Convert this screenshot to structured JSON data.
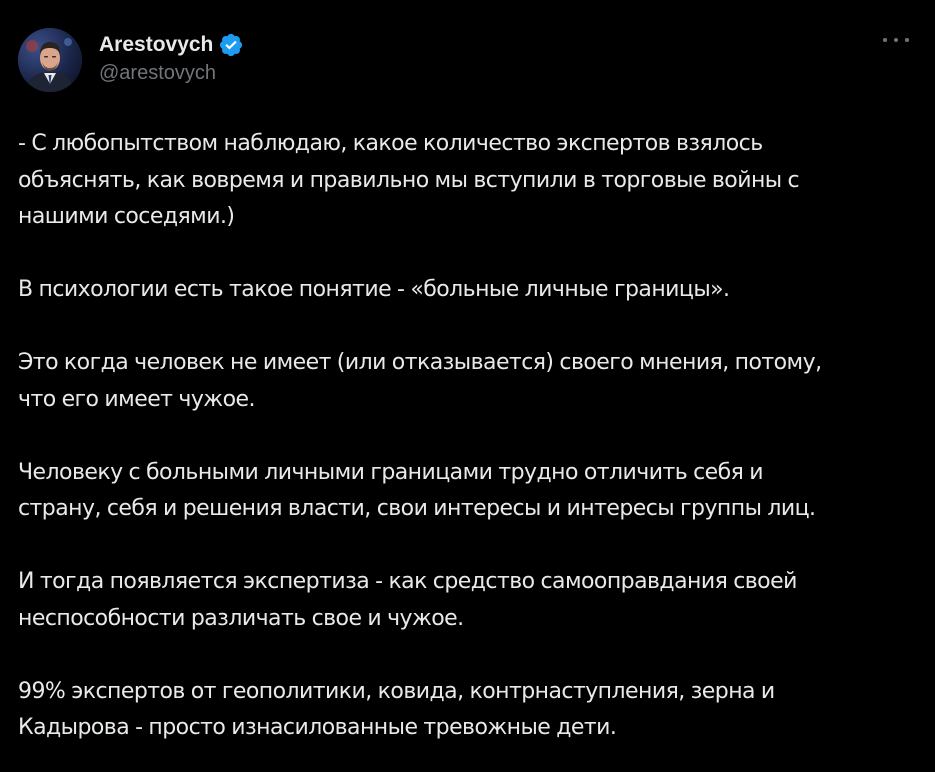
{
  "colors": {
    "background": "#000000",
    "text_primary": "#e7e9ea",
    "text_secondary": "#71767b",
    "verified_badge": "#1d9bf0"
  },
  "author": {
    "display_name": "Arestovych",
    "handle": "@arestovych",
    "verified_icon": "verified-badge-icon",
    "avatar_icon": "avatar-photo"
  },
  "more_menu": {
    "icon": "more-horizontal-icon"
  },
  "tweet": {
    "paragraphs": [
      "- С любопытством наблюдаю, какое количество экспертов взялось\nобъяснять, как вовремя и правильно мы вступили в торговые войны с\nнашими соседями.)",
      "В психологии есть такое понятие - «больные личные границы».",
      "Это когда человек не имеет (или отказывается) своего мнения, потому,\nчто его имеет чужое.",
      "Человеку с больными личными границами трудно отличить себя и\nстрану, себя и решения власти, свои интересы и интересы группы лиц.",
      "И тогда появляется экспертиза - как средство самооправдания своей\nнеспособности различать свое и чужое.",
      "99% экспертов от геополитики, ковида, контрнаступления, зерна и\nКадырова - просто изнасилованные тревожные дети."
    ]
  }
}
